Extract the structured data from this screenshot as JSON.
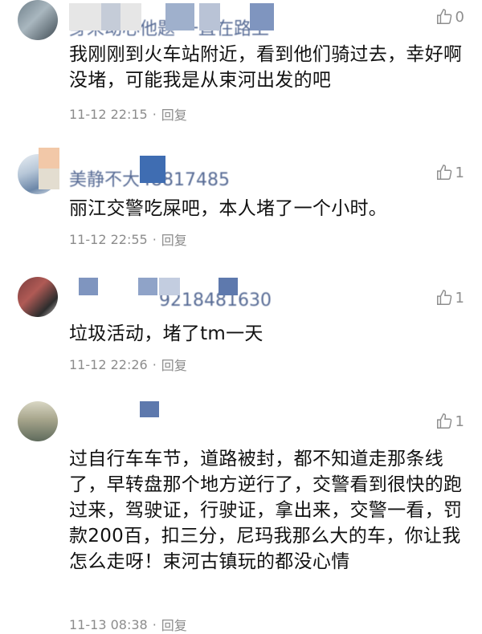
{
  "comments": [
    {
      "name": "身来动心他题 一直在路上",
      "likes": "0",
      "text": "我刚刚到火车站附近，看到他们骑过去，幸好啊没堵，可能我是从束河出发的吧",
      "time": "11-12 22:15",
      "reply": "回复"
    },
    {
      "name": "美静不大48817485",
      "likes": "1",
      "text": "丽江交警吃屎吧，本人堵了一个小时。",
      "time": "11-12 22:55",
      "reply": "回复"
    },
    {
      "name": "9218481630",
      "likes": "1",
      "text": "垃圾活动，堵了tm一天",
      "time": "11-12 22:26",
      "reply": "回复"
    },
    {
      "name": "",
      "likes": "1",
      "text": "过自行车车节，道路被封，都不知道走那条线了，早转盘那个地方逆行了，交警看到很快的跑过来，驾驶证，行驶证，拿出来，交警一看，罚款200百，扣三分，尼玛我那么大的车，你让我怎么走呀！束河古镇玩的都没心情",
      "time": "11-13 08:38",
      "reply": "回复"
    }
  ],
  "separator": "·",
  "icons": {
    "like": "thumbs-up-icon"
  },
  "colors": {
    "name": "#576b95",
    "meta": "#8c8c8c",
    "text": "#111111"
  }
}
